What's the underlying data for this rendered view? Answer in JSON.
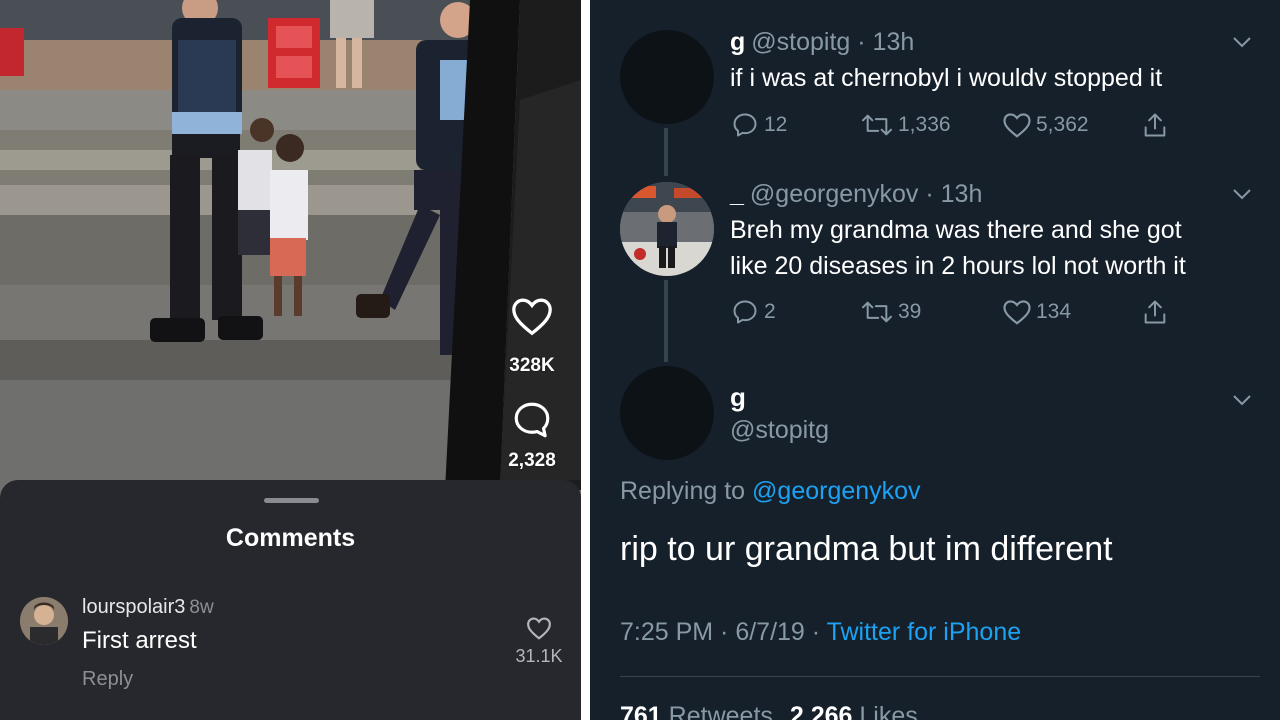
{
  "video": {
    "like_count": "328K",
    "comment_count": "2,328"
  },
  "comments_sheet": {
    "title": "Comments",
    "comment": {
      "username": "lourspolair3",
      "age": "8w",
      "text": "First arrest",
      "reply_label": "Reply",
      "like_count": "31.1K"
    }
  },
  "twitter": {
    "colors": {
      "background": "#15202b",
      "link": "#1da1f2",
      "muted": "#8899a6"
    },
    "tweet1": {
      "display_name": "g",
      "handle_time": "@stopitg · 13h",
      "text": "if i was at chernobyl i wouldv stopped it",
      "replies": "12",
      "retweets": "1,336",
      "likes": "5,362"
    },
    "tweet2": {
      "display_name": "_",
      "handle_time": "@georgenykov · 13h",
      "text_line1": "Breh my grandma was there and she got",
      "text_line2": "like 20 diseases in 2 hours lol not worth it",
      "replies": "2",
      "retweets": "39",
      "likes": "134"
    },
    "main_tweet": {
      "display_name": "g",
      "handle": "@stopitg",
      "replying_prefix": "Replying to",
      "replying_to": "@georgenykov",
      "text": "rip to ur grandma but im different",
      "time_date": "7:25 PM · 6/7/19 ·",
      "source": "Twitter for iPhone",
      "retweet_count": "761",
      "retweet_label": "Retweets",
      "like_count": "2,266",
      "like_label": "Likes"
    }
  }
}
